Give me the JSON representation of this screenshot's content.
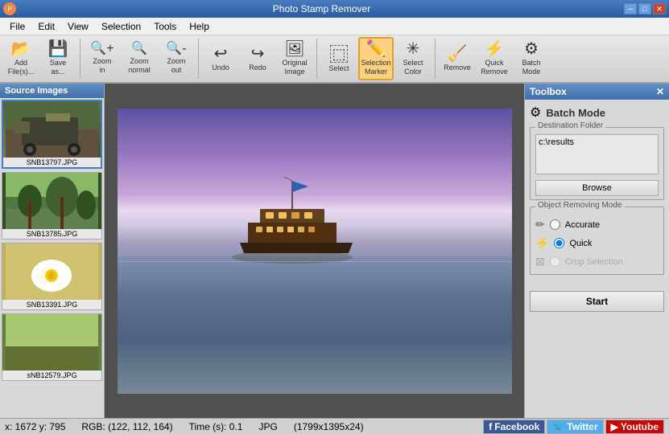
{
  "app": {
    "title": "Photo Stamp Remover"
  },
  "titlebar": {
    "minimize": "─",
    "maximize": "□",
    "close": "✕"
  },
  "menu": {
    "items": [
      "File",
      "Edit",
      "View",
      "Selection",
      "Tools",
      "Help"
    ]
  },
  "toolbar": {
    "buttons": [
      {
        "id": "add-files",
        "label": "Add\nFile(s)...",
        "icon": "📂"
      },
      {
        "id": "save-as",
        "label": "Save\nas...",
        "icon": "💾"
      },
      {
        "id": "zoom-in",
        "label": "Zoom\nin",
        "icon": "🔍"
      },
      {
        "id": "zoom-normal",
        "label": "Zoom\nnormal",
        "icon": "🔍"
      },
      {
        "id": "zoom-out",
        "label": "Zoom\nout",
        "icon": "🔍"
      },
      {
        "id": "undo",
        "label": "Undo",
        "icon": "↩"
      },
      {
        "id": "redo",
        "label": "Redo",
        "icon": "↪"
      },
      {
        "id": "original-image",
        "label": "Original\nImage",
        "icon": "🖼"
      },
      {
        "id": "select",
        "label": "Select",
        "icon": "⬚"
      },
      {
        "id": "selection-marker",
        "label": "Selection\nMarker",
        "icon": "✏️",
        "active": true
      },
      {
        "id": "select-color",
        "label": "Select\nColor",
        "icon": "✳"
      },
      {
        "id": "remove",
        "label": "Remove",
        "icon": "🗑"
      },
      {
        "id": "quick-remove",
        "label": "Quick\nRemove",
        "icon": "⚡"
      },
      {
        "id": "batch-mode",
        "label": "Batch\nMode",
        "icon": "⚙"
      }
    ]
  },
  "source_panel": {
    "title": "Source Images",
    "images": [
      {
        "filename": "SNB13797.JPG",
        "color": "#708060"
      },
      {
        "filename": "SNB13785.JPG",
        "color": "#407030"
      },
      {
        "filename": "SNB13391.JPG",
        "color": "#f0e080"
      },
      {
        "filename": "sNB12579.JPG",
        "color": "#e0f080"
      }
    ]
  },
  "toolbox": {
    "title": "Toolbox",
    "close": "✕",
    "section": "Batch Mode",
    "destination_folder": {
      "label": "Destination Folder",
      "value": "c:\\results"
    },
    "browse_label": "Browse",
    "removing_mode": {
      "label": "Object Removing Mode",
      "options": [
        {
          "id": "accurate",
          "label": "Accurate",
          "selected": false
        },
        {
          "id": "quick",
          "label": "Quick",
          "selected": true
        },
        {
          "id": "crop-selection",
          "label": "Crop Selection",
          "selected": false,
          "disabled": true
        }
      ]
    },
    "start_label": "Start"
  },
  "status": {
    "coords": "x: 1672 y: 795",
    "rgb": "RGB: (122, 112, 164)",
    "time": "Time (s): 0.1",
    "format": "JPG",
    "dimensions": "(1799x1395x24)"
  },
  "social": {
    "facebook": "f  Facebook",
    "twitter": "Twitter",
    "youtube": "Youtube"
  }
}
